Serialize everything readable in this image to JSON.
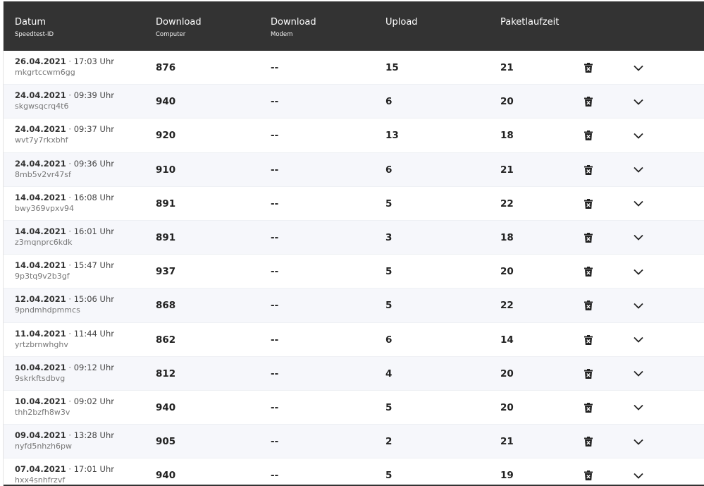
{
  "header": {
    "datum": "Datum",
    "datum_sub": "Speedtest-ID",
    "download_computer": "Download",
    "download_computer_sub": "Computer",
    "download_modem": "Download",
    "download_modem_sub": "Modem",
    "upload": "Upload",
    "paketlaufzeit": "Paketlaufzeit"
  },
  "icons": {
    "delete": "trash-icon",
    "expand": "chevron-down-icon"
  },
  "colors": {
    "header_bg": "#333333",
    "row_alt": "#f6f7fb"
  },
  "rows": [
    {
      "date": "26.04.2021",
      "time": "17:03 Uhr",
      "id": "mkgrtccwm6gg",
      "dl_computer": "876",
      "dl_modem": "--",
      "upload": "15",
      "latency": "21"
    },
    {
      "date": "24.04.2021",
      "time": "09:39 Uhr",
      "id": "skgwsqcrq4t6",
      "dl_computer": "940",
      "dl_modem": "--",
      "upload": "6",
      "latency": "20"
    },
    {
      "date": "24.04.2021",
      "time": "09:37 Uhr",
      "id": "wvt7y7rkxbhf",
      "dl_computer": "920",
      "dl_modem": "--",
      "upload": "13",
      "latency": "18"
    },
    {
      "date": "24.04.2021",
      "time": "09:36 Uhr",
      "id": "8mb5v2vr47sf",
      "dl_computer": "910",
      "dl_modem": "--",
      "upload": "6",
      "latency": "21"
    },
    {
      "date": "14.04.2021",
      "time": "16:08 Uhr",
      "id": "bwy369vpxv94",
      "dl_computer": "891",
      "dl_modem": "--",
      "upload": "5",
      "latency": "22"
    },
    {
      "date": "14.04.2021",
      "time": "16:01 Uhr",
      "id": "z3mqnprc6kdk",
      "dl_computer": "891",
      "dl_modem": "--",
      "upload": "3",
      "latency": "18"
    },
    {
      "date": "14.04.2021",
      "time": "15:47 Uhr",
      "id": "9p3tq9v2b3gf",
      "dl_computer": "937",
      "dl_modem": "--",
      "upload": "5",
      "latency": "20"
    },
    {
      "date": "12.04.2021",
      "time": "15:06 Uhr",
      "id": "9pndmhdpmmcs",
      "dl_computer": "868",
      "dl_modem": "--",
      "upload": "5",
      "latency": "22"
    },
    {
      "date": "11.04.2021",
      "time": "11:44 Uhr",
      "id": "yrtzbrnwhghv",
      "dl_computer": "862",
      "dl_modem": "--",
      "upload": "6",
      "latency": "14"
    },
    {
      "date": "10.04.2021",
      "time": "09:12 Uhr",
      "id": "9skrkftsdbvg",
      "dl_computer": "812",
      "dl_modem": "--",
      "upload": "4",
      "latency": "20"
    },
    {
      "date": "10.04.2021",
      "time": "09:02 Uhr",
      "id": "thh2bzfh8w3v",
      "dl_computer": "940",
      "dl_modem": "--",
      "upload": "5",
      "latency": "20"
    },
    {
      "date": "09.04.2021",
      "time": "13:28 Uhr",
      "id": "nyfd5nhzh6pw",
      "dl_computer": "905",
      "dl_modem": "--",
      "upload": "2",
      "latency": "21"
    },
    {
      "date": "07.04.2021",
      "time": "17:01 Uhr",
      "id": "hxx4snhfrzvf",
      "dl_computer": "940",
      "dl_modem": "--",
      "upload": "5",
      "latency": "19"
    }
  ]
}
